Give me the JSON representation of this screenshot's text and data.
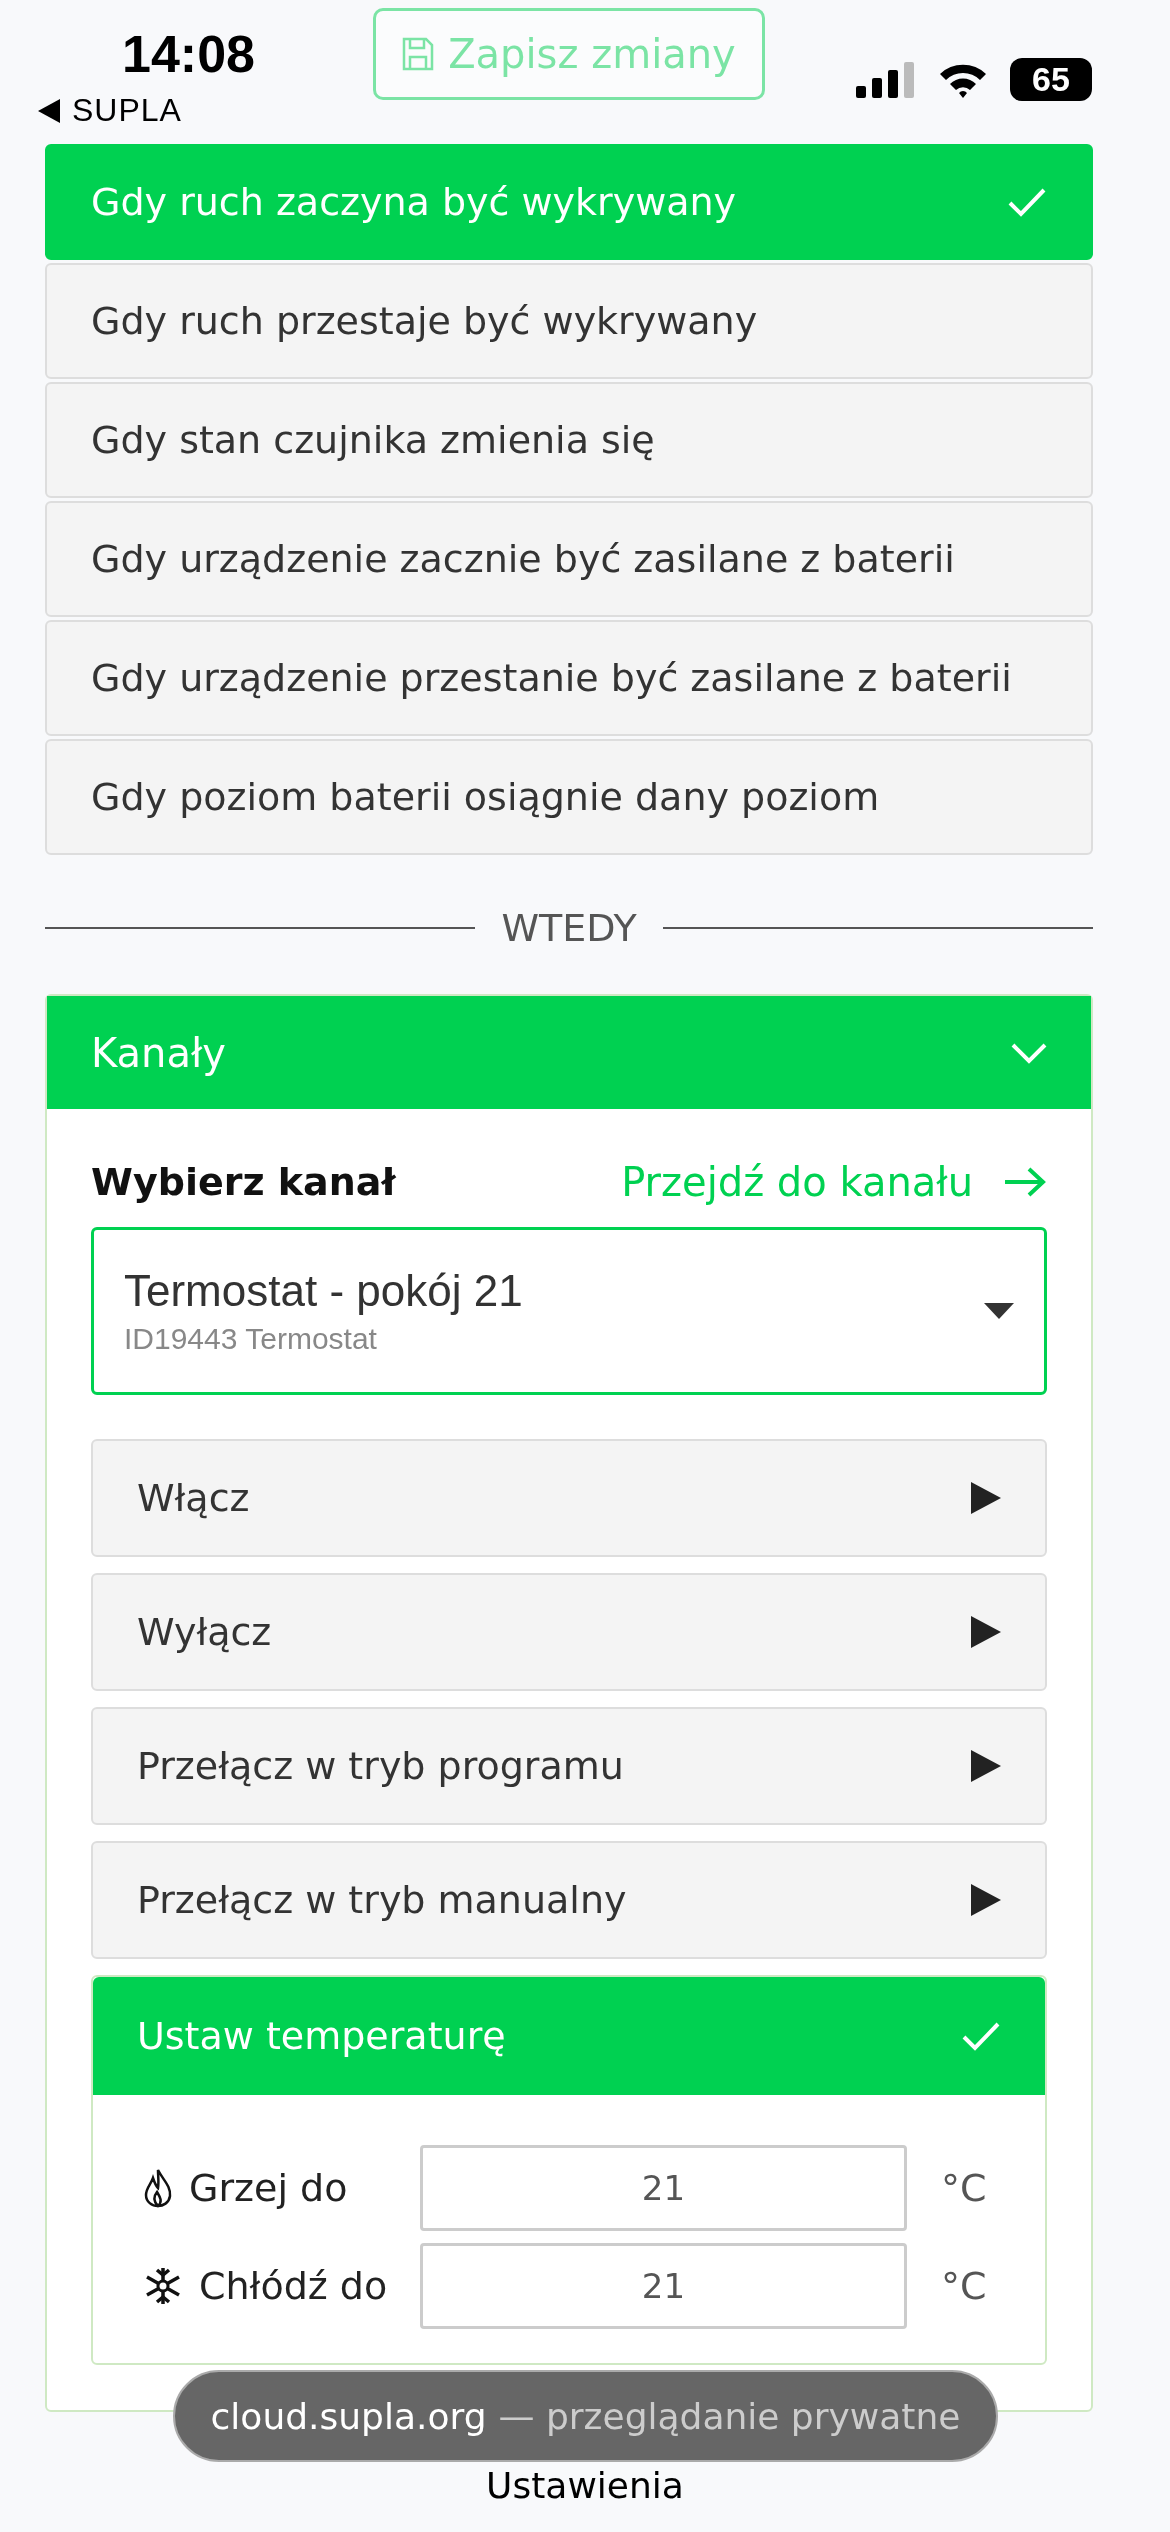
{
  "status_bar": {
    "time": "14:08",
    "back_label": "SUPLA",
    "battery": "65"
  },
  "save_button": {
    "label": "Zapisz zmiany",
    "disabled": true
  },
  "triggers": [
    {
      "label": "Gdy ruch zaczyna być wykrywany",
      "selected": true
    },
    {
      "label": "Gdy ruch przestaje być wykrywany",
      "selected": false
    },
    {
      "label": "Gdy stan czujnika zmienia się",
      "selected": false
    },
    {
      "label": "Gdy urządzenie zacznie być zasilane z baterii",
      "selected": false
    },
    {
      "label": "Gdy urządzenie przestanie być zasilane z baterii",
      "selected": false
    },
    {
      "label": "Gdy poziom baterii osiągnie dany poziom",
      "selected": false
    }
  ],
  "divider_label": "WTEDY",
  "channels_panel": {
    "title": "Kanały",
    "expanded": true,
    "select_label": "Wybierz kanał",
    "go_to_link": "Przejdź do kanału",
    "select": {
      "value": "Termostat - pokój 21",
      "subtitle": "ID19443 Termostat"
    },
    "actions": [
      {
        "label": "Włącz",
        "selected": false
      },
      {
        "label": "Wyłącz",
        "selected": false
      },
      {
        "label": "Przełącz w tryb programu",
        "selected": false
      },
      {
        "label": "Przełącz w tryb manualny",
        "selected": false
      },
      {
        "label": "Ustaw temperaturę",
        "selected": true,
        "fields": [
          {
            "kind": "heat",
            "label": "Grzej do",
            "value": "21",
            "unit": "°C"
          },
          {
            "kind": "cool",
            "label": "Chłódź do",
            "value": "21",
            "unit": "°C"
          }
        ]
      }
    ]
  },
  "browser_toast": {
    "host": "cloud.supla.org",
    "mode": "— przeglądanie prywatne"
  },
  "next_heading": "Ustawienia"
}
